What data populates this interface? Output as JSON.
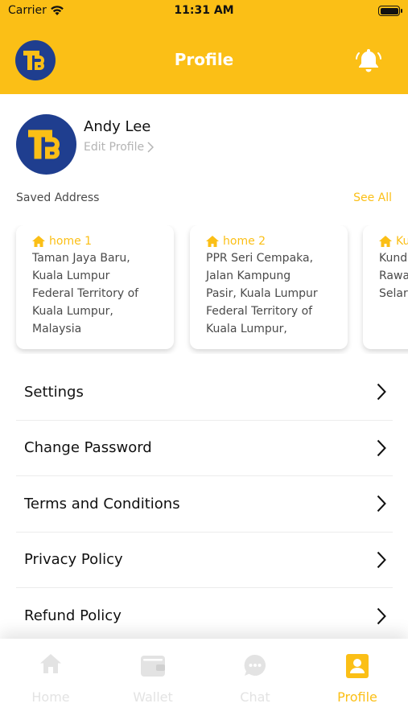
{
  "status_bar": {
    "carrier": "Carrier",
    "time": "11:31 AM"
  },
  "header": {
    "title": "Profile"
  },
  "profile": {
    "name": "Andy Lee",
    "edit_label": "Edit Profile"
  },
  "saved_address": {
    "label": "Saved Address",
    "see_all": "See All"
  },
  "addresses": [
    {
      "title": "home 1",
      "address": "Taman Jaya Baru,\nKuala Lumpur\nFederal Territory of\nKuala Lumpur,\nMalaysia"
    },
    {
      "title": "home 2",
      "address": "PPR Seri Cempaka,\nJalan Kampung\nPasir, Kuala Lumpur\nFederal Territory of\nKuala Lumpur,"
    },
    {
      "title": "Ku",
      "address": "Kund\nRawa\nSelar"
    }
  ],
  "menu": [
    {
      "label": "Settings"
    },
    {
      "label": "Change Password"
    },
    {
      "label": "Terms and Conditions"
    },
    {
      "label": "Privacy Policy"
    },
    {
      "label": "Refund Policy"
    }
  ],
  "tabs": [
    {
      "label": "Home",
      "icon": "home-icon",
      "active": false
    },
    {
      "label": "Wallet",
      "icon": "wallet-icon",
      "active": false
    },
    {
      "label": "Chat",
      "icon": "chat-icon",
      "active": false
    },
    {
      "label": "Profile",
      "icon": "profile-icon",
      "active": true
    }
  ],
  "colors": {
    "brand_yellow": "#FBBF16",
    "brand_navy": "#1F3E8F",
    "inactive": "#e3e3e3"
  }
}
